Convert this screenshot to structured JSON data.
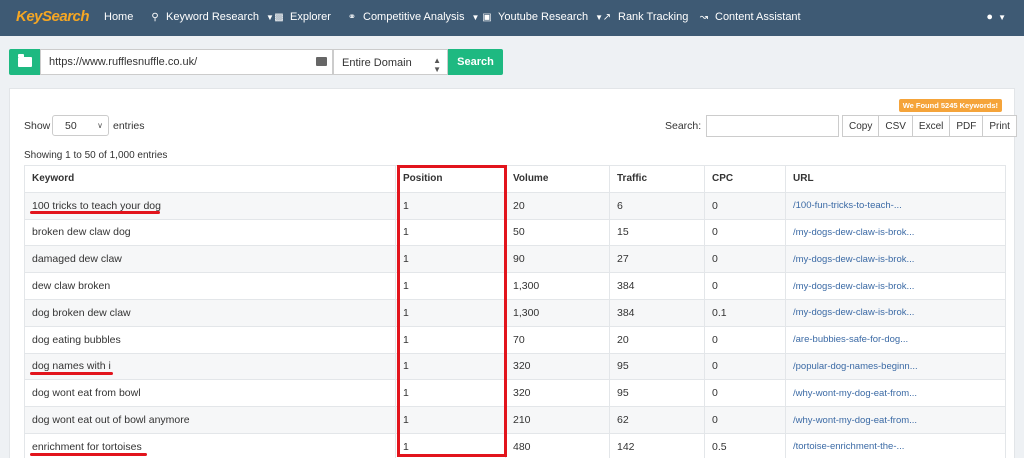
{
  "brand": {
    "logo_text": "KeySearch"
  },
  "nav": {
    "items": [
      {
        "label": "Home",
        "icon": ""
      },
      {
        "label": "Keyword Research",
        "icon": "search-icon",
        "dropdown": true
      },
      {
        "label": "Explorer",
        "icon": "bar-chart-icon"
      },
      {
        "label": "Competitive Analysis",
        "icon": "link-icon",
        "dropdown": true
      },
      {
        "label": "Youtube Research",
        "icon": "video-icon",
        "dropdown": true
      },
      {
        "label": "Rank Tracking",
        "icon": "trend-up-icon"
      },
      {
        "label": "Content Assistant",
        "icon": "line-chart-icon"
      }
    ]
  },
  "search": {
    "url_value": "https://www.rufflesnuffle.co.uk/",
    "scope_value": "Entire Domain",
    "button_label": "Search"
  },
  "panel": {
    "found_badge": "We Found 5245 Keywords!",
    "show_label": "Show",
    "entries_value": "50",
    "entries_label": "entries",
    "search_label": "Search:",
    "export_buttons": [
      "Copy",
      "CSV",
      "Excel",
      "PDF",
      "Print"
    ],
    "showing_text": "Showing 1 to 50 of 1,000 entries"
  },
  "table": {
    "headers": [
      "Keyword",
      "Position",
      "Volume",
      "Traffic",
      "CPC",
      "URL"
    ],
    "rows": [
      [
        "100 tricks to teach your dog",
        "1",
        "20",
        "6",
        "0",
        "/100-fun-tricks-to-teach-..."
      ],
      [
        "broken dew claw dog",
        "1",
        "50",
        "15",
        "0",
        "/my-dogs-dew-claw-is-brok..."
      ],
      [
        "damaged dew claw",
        "1",
        "90",
        "27",
        "0",
        "/my-dogs-dew-claw-is-brok..."
      ],
      [
        "dew claw broken",
        "1",
        "1,300",
        "384",
        "0",
        "/my-dogs-dew-claw-is-brok..."
      ],
      [
        "dog broken dew claw",
        "1",
        "1,300",
        "384",
        "0.1",
        "/my-dogs-dew-claw-is-brok..."
      ],
      [
        "dog eating bubbles",
        "1",
        "70",
        "20",
        "0",
        "/are-bubbies-safe-for-dog..."
      ],
      [
        "dog names with i",
        "1",
        "320",
        "95",
        "0",
        "/popular-dog-names-beginn..."
      ],
      [
        "dog wont eat from bowl",
        "1",
        "320",
        "95",
        "0",
        "/why-wont-my-dog-eat-from..."
      ],
      [
        "dog wont eat out of bowl anymore",
        "1",
        "210",
        "62",
        "0",
        "/why-wont-my-dog-eat-from..."
      ],
      [
        "enrichment for tortoises",
        "1",
        "480",
        "142",
        "0.5",
        "/tortoise-enrichment-the-..."
      ]
    ]
  },
  "colors": {
    "nav_bg": "#3e5a74",
    "accent_green": "#1eb981",
    "badge_orange": "#f5a43a",
    "annotation_red": "#e2141c",
    "link_blue": "#3b6aa5"
  }
}
